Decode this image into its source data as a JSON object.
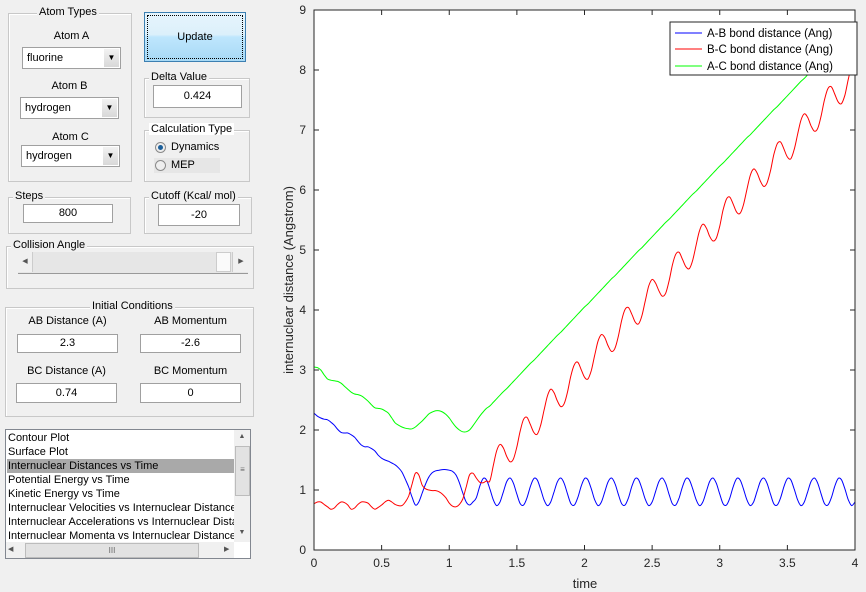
{
  "atom_types": {
    "title": "Atom Types",
    "atom_a": {
      "label": "Atom A",
      "value": "fluorine"
    },
    "atom_b": {
      "label": "Atom B",
      "value": "hydrogen"
    },
    "atom_c": {
      "label": "Atom C",
      "value": "hydrogen"
    }
  },
  "update_label": "Update",
  "delta": {
    "label": "Delta Value",
    "value": "0.424"
  },
  "calc_type": {
    "title": "Calculation Type",
    "options": [
      "Dynamics",
      "MEP"
    ],
    "selected": "Dynamics"
  },
  "steps": {
    "label": "Steps",
    "value": "800"
  },
  "cutoff": {
    "label": "Cutoff (Kcal/ mol)",
    "value": "-20"
  },
  "collision": {
    "label": "Collision Angle",
    "slider_fraction": 1.0
  },
  "initial": {
    "title": "Initial Conditions",
    "ab_distance": {
      "label": "AB Distance (A)",
      "value": "2.3"
    },
    "ab_momentum": {
      "label": "AB Momentum",
      "value": "-2.6"
    },
    "bc_distance": {
      "label": "BC Distance (A)",
      "value": "0.74"
    },
    "bc_momentum": {
      "label": "BC Momentum",
      "value": "0"
    }
  },
  "plot_list": {
    "items": [
      "Contour Plot",
      "Surface Plot",
      "Internuclear Distances vs Time",
      "Potential Energy vs Time",
      "Kinetic Energy vs Time",
      "Internuclear Velocities vs Internuclear Distance",
      "Internuclear Accelerations vs Internuclear Distance",
      "Internuclear Momenta vs Internuclear Distance"
    ],
    "selected_index": 2
  },
  "chart_data": {
    "type": "line",
    "xlabel": "time",
    "ylabel": "internuclear distance (Angstrom)",
    "xlim": [
      0,
      4
    ],
    "ylim": [
      0,
      9
    ],
    "xticks": [
      "0",
      "0.5",
      "1",
      "1.5",
      "2",
      "2.5",
      "3",
      "3.5",
      "4"
    ],
    "yticks": [
      "0",
      "1",
      "2",
      "3",
      "4",
      "5",
      "6",
      "7",
      "8",
      "9"
    ],
    "grid": false,
    "legend": "top-right",
    "t": [
      0,
      0.025,
      0.05,
      0.075,
      0.1,
      0.125,
      0.15,
      0.175,
      0.2,
      0.225,
      0.25,
      0.275,
      0.3,
      0.325,
      0.35,
      0.375,
      0.4,
      0.425,
      0.45,
      0.475,
      0.5,
      0.525,
      0.55,
      0.575,
      0.6,
      0.625,
      0.65,
      0.675,
      0.7,
      0.725,
      0.75,
      0.775,
      0.8,
      0.825,
      0.85,
      0.875,
      0.9,
      0.925,
      0.95,
      0.975,
      1,
      1.025,
      1.05,
      1.075,
      1.1,
      1.125,
      1.15,
      1.175,
      1.2,
      1.225,
      1.25,
      1.275,
      1.3,
      1.325,
      1.35,
      1.375,
      1.4,
      1.425,
      1.45,
      1.475,
      1.5,
      1.525,
      1.55,
      1.575,
      1.6,
      1.625,
      1.65,
      1.675,
      1.7,
      1.725,
      1.75,
      1.775,
      1.8,
      1.825,
      1.85,
      1.875,
      1.9,
      1.925,
      1.95,
      1.975,
      2,
      2.025,
      2.05,
      2.075,
      2.1,
      2.125,
      2.15,
      2.175,
      2.2,
      2.225,
      2.25,
      2.275,
      2.3,
      2.325,
      2.35,
      2.375,
      2.4,
      2.425,
      2.45,
      2.475,
      2.5,
      2.525,
      2.55,
      2.575,
      2.6,
      2.625,
      2.65,
      2.675,
      2.7,
      2.725,
      2.75,
      2.775,
      2.8,
      2.825,
      2.85,
      2.875,
      2.9,
      2.925,
      2.95,
      2.975,
      3,
      3.025,
      3.05,
      3.075,
      3.1,
      3.125,
      3.15,
      3.175,
      3.2,
      3.225,
      3.25,
      3.275,
      3.3,
      3.325,
      3.35,
      3.375,
      3.4,
      3.425,
      3.45,
      3.475,
      3.5,
      3.525,
      3.55,
      3.575,
      3.6,
      3.625,
      3.65,
      3.675,
      3.7,
      3.725,
      3.75,
      3.775,
      3.8,
      3.825,
      3.85,
      3.875,
      3.9,
      3.925,
      3.95,
      3.975,
      4
    ],
    "series": [
      {
        "name": "A-B bond distance (Ang)",
        "color": "#0000ff",
        "values": [
          2.28,
          2.23,
          2.2,
          2.18,
          2.17,
          2.13,
          2.08,
          2.01,
          1.96,
          1.95,
          1.95,
          1.92,
          1.88,
          1.81,
          1.75,
          1.72,
          1.72,
          1.69,
          1.65,
          1.58,
          1.53,
          1.5,
          1.48,
          1.45,
          1.42,
          1.37,
          1.3,
          1.18,
          1.05,
          0.88,
          0.75,
          0.8,
          0.95,
          1.1,
          1.22,
          1.29,
          1.32,
          1.33,
          1.34,
          1.34,
          1.33,
          1.31,
          1.25,
          1.12,
          0.95,
          0.8,
          0.75,
          0.8,
          0.87,
          1.06,
          1.19,
          1.17,
          1.02,
          0.84,
          0.74,
          0.8,
          0.97,
          1.14,
          1.2,
          1.11,
          0.93,
          0.77,
          0.75,
          0.87,
          1.06,
          1.19,
          1.17,
          1.02,
          0.84,
          0.74,
          0.8,
          0.97,
          1.14,
          1.2,
          1.11,
          0.93,
          0.77,
          0.75,
          0.87,
          1.06,
          1.19,
          1.17,
          1.02,
          0.84,
          0.74,
          0.8,
          0.97,
          1.14,
          1.2,
          1.11,
          0.93,
          0.77,
          0.75,
          0.87,
          1.06,
          1.19,
          1.17,
          1.02,
          0.84,
          0.74,
          0.8,
          0.97,
          1.14,
          1.2,
          1.11,
          0.93,
          0.77,
          0.75,
          0.87,
          1.06,
          1.19,
          1.17,
          1.02,
          0.84,
          0.74,
          0.8,
          0.97,
          1.14,
          1.2,
          1.11,
          0.93,
          0.77,
          0.75,
          0.87,
          1.06,
          1.19,
          1.17,
          1.02,
          0.84,
          0.74,
          0.8,
          0.97,
          1.14,
          1.2,
          1.11,
          0.93,
          0.77,
          0.75,
          0.87,
          1.06,
          1.19,
          1.17,
          1.02,
          0.84,
          0.74,
          0.8,
          0.97,
          1.14,
          1.2,
          1.11,
          0.93,
          0.77,
          0.75,
          0.87,
          1.06,
          1.19,
          1.17,
          1.02,
          0.84,
          0.74,
          0.8
        ]
      },
      {
        "name": "B-C bond distance (Ang)",
        "color": "#ff0000",
        "values": [
          0.77,
          0.8,
          0.8,
          0.76,
          0.72,
          0.68,
          0.7,
          0.76,
          0.8,
          0.79,
          0.75,
          0.68,
          0.7,
          0.76,
          0.8,
          0.8,
          0.78,
          0.72,
          0.68,
          0.71,
          0.75,
          0.8,
          0.83,
          0.8,
          0.76,
          0.74,
          0.74,
          0.8,
          0.9,
          1.1,
          1.28,
          1.25,
          1.08,
          1.02,
          1.0,
          0.99,
          0.99,
          0.97,
          0.93,
          0.87,
          0.78,
          0.73,
          0.72,
          0.76,
          0.85,
          1.05,
          1.25,
          1.28,
          1.2,
          1.13,
          1.12,
          1.15,
          1.15,
          1.4,
          1.65,
          1.76,
          1.7,
          1.56,
          1.47,
          1.52,
          1.72,
          1.99,
          2.18,
          2.21,
          2.09,
          1.96,
          1.93,
          2.07,
          2.32,
          2.56,
          2.68,
          2.62,
          2.48,
          2.39,
          2.44,
          2.64,
          2.91,
          3.09,
          3.13,
          3.01,
          2.88,
          2.85,
          2.99,
          3.24,
          3.48,
          3.59,
          3.54,
          3.4,
          3.31,
          3.36,
          3.56,
          3.83,
          4.01,
          4.04,
          3.93,
          3.8,
          3.77,
          3.91,
          4.16,
          4.4,
          4.51,
          4.45,
          4.32,
          4.23,
          4.28,
          4.48,
          4.75,
          4.93,
          4.96,
          4.84,
          4.72,
          4.69,
          4.83,
          5.08,
          5.32,
          5.43,
          5.37,
          5.23,
          5.15,
          5.2,
          5.4,
          5.67,
          5.85,
          5.88,
          5.76,
          5.63,
          5.61,
          5.75,
          6.0,
          6.24,
          6.35,
          6.29,
          6.15,
          6.06,
          6.12,
          6.32,
          6.59,
          6.77,
          6.8,
          6.68,
          6.55,
          6.52,
          6.67,
          6.92,
          7.16,
          7.27,
          7.21,
          7.07,
          6.98,
          7.03,
          7.24,
          7.51,
          7.69,
          7.72,
          7.6,
          7.47,
          7.44,
          7.58,
          7.84,
          8.08,
          8.19
        ]
      },
      {
        "name": "A-C bond distance (Ang)",
        "color": "#00ff00",
        "values": [
          3.05,
          3.04,
          3.0,
          2.92,
          2.85,
          2.83,
          2.82,
          2.81,
          2.78,
          2.73,
          2.68,
          2.63,
          2.6,
          2.59,
          2.57,
          2.53,
          2.48,
          2.42,
          2.37,
          2.36,
          2.35,
          2.32,
          2.28,
          2.2,
          2.12,
          2.08,
          2.05,
          2.03,
          2.02,
          2.02,
          2.05,
          2.1,
          2.15,
          2.21,
          2.27,
          2.3,
          2.32,
          2.32,
          2.3,
          2.26,
          2.2,
          2.12,
          2.05,
          2.0,
          1.97,
          1.97,
          2.0,
          2.07,
          2.15,
          2.23,
          2.3,
          2.36,
          2.4,
          2.46,
          2.52,
          2.58,
          2.64,
          2.69,
          2.75,
          2.81,
          2.87,
          2.93,
          2.99,
          3.05,
          3.11,
          3.16,
          3.22,
          3.28,
          3.34,
          3.4,
          3.46,
          3.52,
          3.58,
          3.63,
          3.69,
          3.75,
          3.81,
          3.87,
          3.93,
          3.99,
          4.05,
          4.1,
          4.16,
          4.22,
          4.28,
          4.34,
          4.4,
          4.46,
          4.52,
          4.57,
          4.63,
          4.69,
          4.75,
          4.81,
          4.87,
          4.93,
          4.99,
          5.04,
          5.1,
          5.16,
          5.22,
          5.28,
          5.34,
          5.4,
          5.46,
          5.51,
          5.57,
          5.63,
          5.69,
          5.75,
          5.81,
          5.87,
          5.93,
          5.98,
          6.04,
          6.1,
          6.16,
          6.22,
          6.28,
          6.34,
          6.4,
          6.45,
          6.51,
          6.57,
          6.63,
          6.69,
          6.75,
          6.81,
          6.87,
          6.92,
          6.98,
          7.04,
          7.1,
          7.16,
          7.22,
          7.28,
          7.34,
          7.39,
          7.45,
          7.51,
          7.57,
          7.63,
          7.69,
          7.75,
          7.81,
          7.86,
          7.92,
          7.98,
          8.04,
          8.1,
          8.16,
          8.22,
          8.28,
          8.33,
          8.39,
          8.45,
          8.51,
          8.57,
          8.63,
          8.69,
          8.75
        ]
      }
    ]
  }
}
